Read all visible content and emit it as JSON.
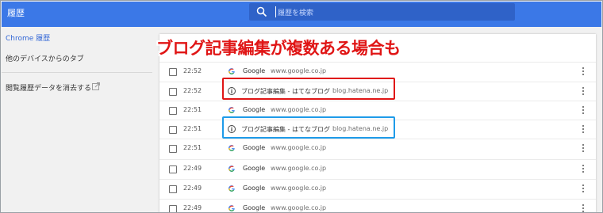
{
  "app": {
    "title": "履歴"
  },
  "search": {
    "placeholder": "履歴を検索"
  },
  "sidebar": {
    "items": [
      {
        "label": "Chrome 履歴"
      },
      {
        "label": "他のデバイスからのタブ"
      },
      {
        "label": "閲覧履歴データを消去する"
      }
    ]
  },
  "annotation": {
    "text": "ブログ記事編集が複数ある場合も"
  },
  "history": {
    "rows": [
      {
        "time": "22:52",
        "title": "Google",
        "domain": "www.google.co.jp",
        "favicon": "google-icon"
      },
      {
        "time": "22:52",
        "title": "ブログ記事編集 - はてなブログ",
        "domain": "blog.hatena.ne.jp",
        "favicon": "info-circle-icon"
      },
      {
        "time": "22:51",
        "title": "Google",
        "domain": "www.google.co.jp",
        "favicon": "google-icon"
      },
      {
        "time": "22:51",
        "title": "ブログ記事編集 - はてなブログ",
        "domain": "blog.hatena.ne.jp",
        "favicon": "info-circle-icon"
      },
      {
        "time": "22:51",
        "title": "Google",
        "domain": "www.google.co.jp",
        "favicon": "google-icon"
      },
      {
        "time": "22:49",
        "title": "Google",
        "domain": "www.google.co.jp",
        "favicon": "google-icon"
      },
      {
        "time": "22:49",
        "title": "Google",
        "domain": "www.google.co.jp",
        "favicon": "google-icon"
      },
      {
        "time": "22:49",
        "title": "Google",
        "domain": "www.google.co.jp",
        "favicon": "google-icon"
      }
    ]
  },
  "colors": {
    "header": "#3b78e7",
    "highlight_red": "#e01515",
    "highlight_blue": "#1e9be9",
    "annotation": "#e01515"
  }
}
